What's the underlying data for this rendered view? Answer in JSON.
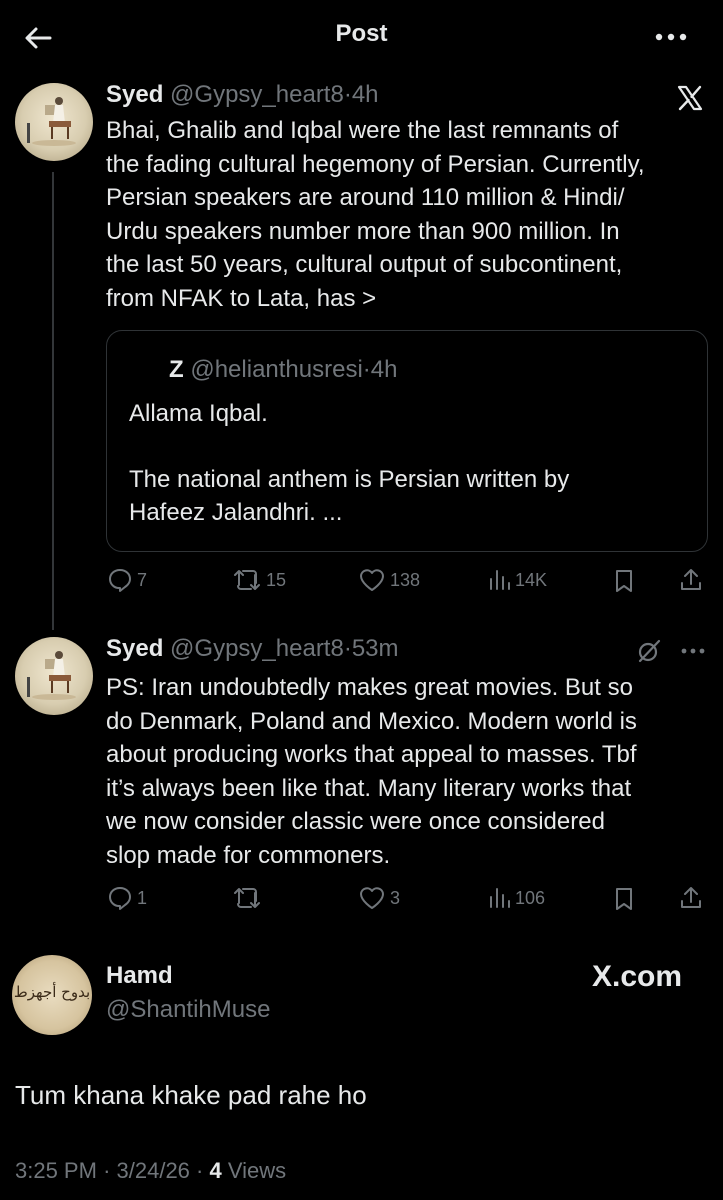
{
  "header": {
    "title": "Post"
  },
  "tweets": [
    {
      "name": "Syed",
      "handle": "@Gypsy_heart8",
      "sep": "·",
      "time": "4h",
      "text": "Bhai, Ghalib and Iqbal were the last remnants of\nthe fading cultural hegemony of Persian. Currently,\nPersian speakers are around 110 million & Hindi/\nUrdu speakers number more than 900 million. In\nthe last 50 years, cultural output of subcontinent,\nfrom NFAK to Lata, has >",
      "quote": {
        "name": "Z",
        "handle": "@helianthusresi",
        "sep": "·",
        "time": "4h",
        "text": "Allama Iqbal.\n\nThe national anthem is Persian written by\nHafeez Jalandhri. ..."
      },
      "stats": {
        "replies": "7",
        "reposts": "15",
        "likes": "138",
        "views": "14K"
      }
    },
    {
      "name": "Syed",
      "handle": "@Gypsy_heart8",
      "sep": "·",
      "time": "53m",
      "text": "PS: Iran undoubtedly makes great movies. But so\ndo Denmark, Poland and Mexico. Modern world is\nabout producing works that appeal to masses. Tbf\nit’s always been like that. Many literary works that\nwe now consider classic were once considered\nslop made for commoners.",
      "stats": {
        "replies": "1",
        "reposts": "",
        "likes": "3",
        "views": "106"
      }
    }
  ],
  "main_post": {
    "name": "Hamd",
    "handle": "@ShantihMuse",
    "avatar_script": "بدوح أجهزط",
    "xcom_label": "X.com",
    "text": "Tum khana khake pad rahe ho",
    "time": "3:25 PM",
    "sep": "·",
    "date": "3/24/26",
    "sep2": "·",
    "views_count": "4",
    "views_label": "Views"
  },
  "icons": [
    "back-arrow-icon",
    "more-icon",
    "x-logo-icon",
    "reply-icon",
    "repost-icon",
    "like-icon",
    "views-icon",
    "bookmark-icon",
    "share-icon",
    "grok-icon"
  ],
  "colors": {
    "background": "#000000",
    "text": "#e7e9ea",
    "muted": "#71767b",
    "border": "#2f3336"
  }
}
